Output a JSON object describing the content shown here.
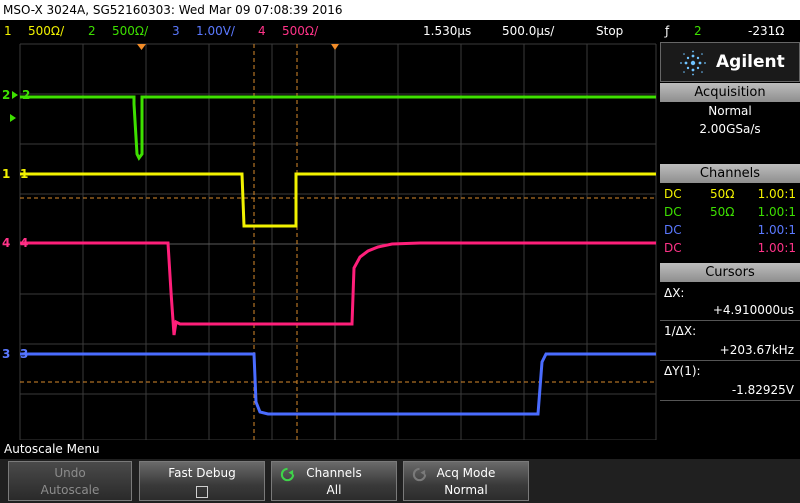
{
  "title_bar": "MSO-X 3024A, SG52160303: Wed Mar 09 07:08:39 2016",
  "status": {
    "ch1": {
      "num": "1",
      "scale": "500Ω/",
      "color": "#f2f200"
    },
    "ch2": {
      "num": "2",
      "scale": "500Ω/",
      "color": "#3ee000"
    },
    "ch3": {
      "num": "3",
      "scale": "1.00V/",
      "color": "#5b79ff"
    },
    "ch4": {
      "num": "4",
      "scale": "500Ω/",
      "color": "#ff3388"
    },
    "delay": "1.530μs",
    "timebase": "500.0μs/",
    "run_state": "Stop",
    "trigger_symbol": "ƒ",
    "trigger_channel": "2",
    "trigger_level": "-231Ω"
  },
  "channel_markers": {
    "ch1": "1",
    "ch2": "2",
    "ch3": "3",
    "ch4": "4"
  },
  "brand": {
    "name": "Agilent",
    "icon": "agilent-spark-icon"
  },
  "acquisition": {
    "header": "Acquisition",
    "mode": "Normal",
    "rate": "2.00GSa/s"
  },
  "channels_panel": {
    "header": "Channels",
    "rows": [
      {
        "coupling": "DC",
        "impedance": "50Ω",
        "probe": "1.00:1",
        "color": "#f2f200"
      },
      {
        "coupling": "DC",
        "impedance": "50Ω",
        "probe": "1.00:1",
        "color": "#3ee000"
      },
      {
        "coupling": "DC",
        "impedance": "",
        "probe": "1.00:1",
        "color": "#5b79ff"
      },
      {
        "coupling": "DC",
        "impedance": "",
        "probe": "1.00:1",
        "color": "#ff3388"
      }
    ]
  },
  "cursors": {
    "header": "Cursors",
    "dx_label": "ΔX:",
    "dx_value": "+4.910000us",
    "inv_dx_label": "1/ΔX:",
    "inv_dx_value": "+203.67kHz",
    "dy_label": "ΔY(1):",
    "dy_value": "-1.82925V"
  },
  "menu": {
    "title": "Autoscale Menu",
    "softkeys": [
      {
        "line1": "Undo",
        "line2": "Autoscale",
        "enabled": false
      },
      {
        "line1": "Fast Debug",
        "line2": "",
        "enabled": true
      },
      {
        "line1": "Channels",
        "line2": "All",
        "enabled": true
      },
      {
        "line1": "Acq Mode",
        "line2": "Normal",
        "enabled": true
      }
    ]
  }
}
